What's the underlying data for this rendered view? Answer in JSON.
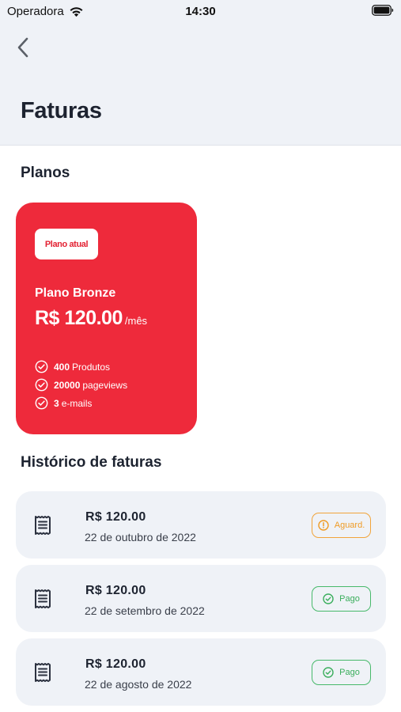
{
  "status_bar": {
    "carrier": "Operadora",
    "time": "14:30"
  },
  "header": {
    "title": "Faturas"
  },
  "plans_section": {
    "title": "Planos",
    "card": {
      "badge": "Plano atual",
      "name": "Plano Bronze",
      "price": "R$ 120.00",
      "period": "/mês",
      "features": [
        {
          "value": "400",
          "label": "Produtos"
        },
        {
          "value": "20000",
          "label": "pageviews"
        },
        {
          "value": "3",
          "label": "e-mails"
        }
      ],
      "color": "#ee2a3b"
    }
  },
  "history_section": {
    "title": "Histórico de faturas",
    "invoices": [
      {
        "amount": "R$ 120.00",
        "date": "22 de outubro de 2022",
        "status": "Aguard.",
        "status_icon": "alert-circle-icon",
        "status_color": "#ef9b24"
      },
      {
        "amount": "R$ 120.00",
        "date": "22 de setembro de 2022",
        "status": "Pago",
        "status_icon": "check-circle-icon",
        "status_color": "#3aae5c"
      },
      {
        "amount": "R$ 120.00",
        "date": "22 de agosto de 2022",
        "status": "Pago",
        "status_icon": "check-circle-icon",
        "status_color": "#3aae5c"
      }
    ]
  }
}
